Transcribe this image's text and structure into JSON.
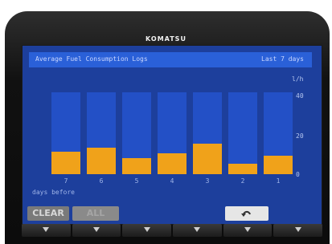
{
  "brand": "KOMATSU",
  "screen": {
    "title": "Average Fuel Consumption Logs",
    "range": "Last 7 days",
    "unit": "l/h"
  },
  "chart_data": {
    "type": "bar",
    "title": "Average Fuel Consumption Logs",
    "xlabel": "days before",
    "ylabel": "l/h",
    "categories": [
      "7",
      "6",
      "5",
      "4",
      "3",
      "2",
      "1"
    ],
    "values": [
      11,
      13,
      8,
      10,
      15,
      5,
      9
    ],
    "ylim": [
      0,
      40
    ],
    "yticks": [
      "40",
      "20",
      "0"
    ],
    "colors": {
      "fill": "#f0a21a",
      "track": "#2350c6"
    }
  },
  "buttons": {
    "clear": "CLEAR",
    "all": "ALL",
    "return_icon": "return-arrow-icon"
  },
  "function_keys": [
    "F1",
    "F2",
    "F3",
    "F4",
    "F5",
    "F6"
  ]
}
